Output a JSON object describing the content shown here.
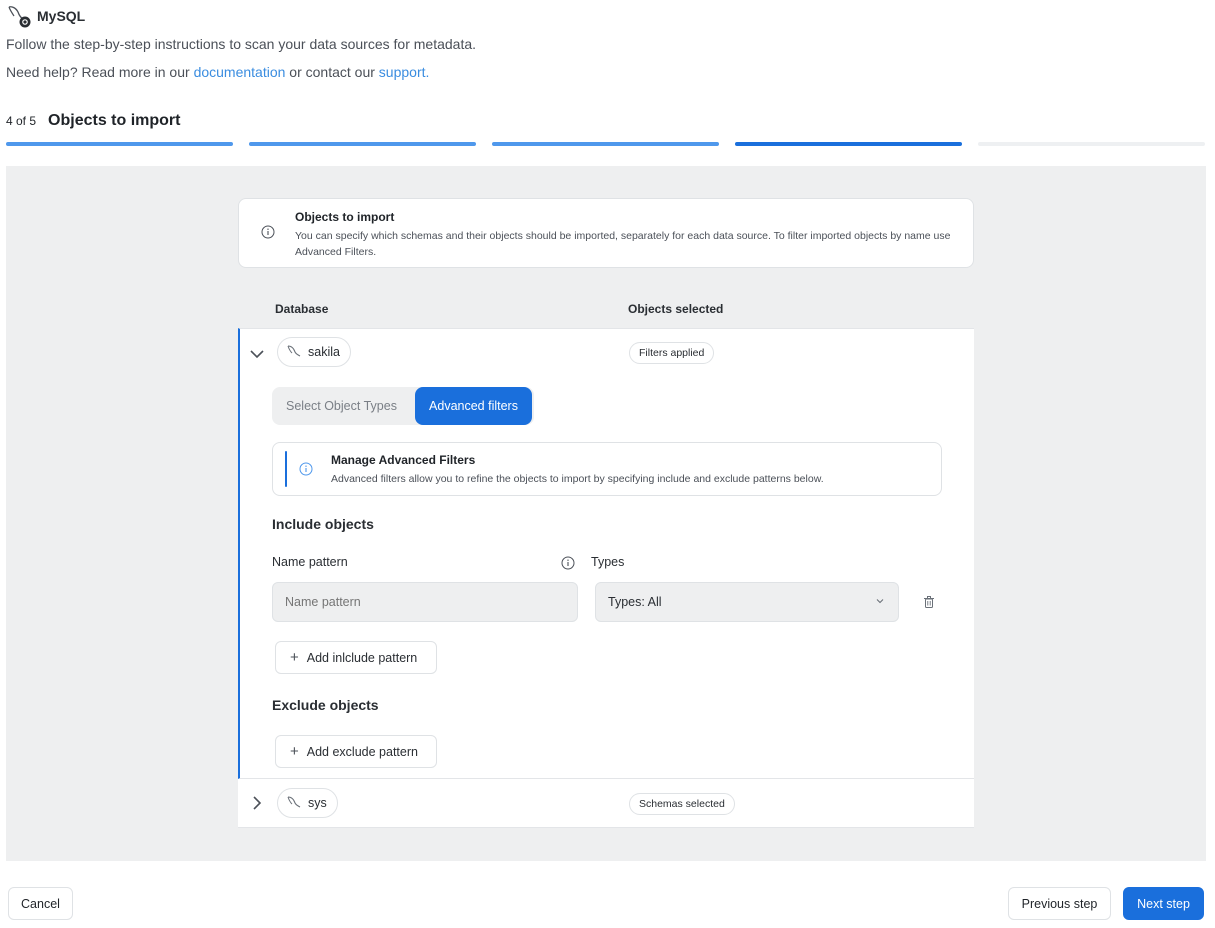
{
  "app": {
    "title": "MySQL",
    "icon": "mysql-dolphin-icon"
  },
  "intro": {
    "text": "Follow the step-by-step instructions to scan your data sources for metadata.",
    "help_prefix": "Need help? Read more in our ",
    "documentation_link": "documentation",
    "help_middle": " or contact our ",
    "support_link": "support."
  },
  "wizard": {
    "step_count": "4 of 5",
    "step_title": "Objects to import",
    "current_step": 4,
    "total_steps": 5
  },
  "info": {
    "title": "Objects to import",
    "description": "You can specify which schemas and their objects should be imported, separately for each data source. To filter imported objects by name use Advanced Filters."
  },
  "table": {
    "col_database": "Database",
    "col_objects": "Objects selected",
    "rows": [
      {
        "name": "sakila",
        "status": "Filters applied",
        "expanded": true
      },
      {
        "name": "sys",
        "status": "Schemas selected",
        "expanded": false
      }
    ]
  },
  "filters": {
    "tab_object_types": "Select Object Types",
    "tab_advanced": "Advanced filters",
    "adv_title": "Manage Advanced Filters",
    "adv_description": "Advanced filters allow you to refine the objects to import by specifying include and exclude patterns below.",
    "include_title": "Include objects",
    "name_pattern_label": "Name pattern",
    "name_pattern_placeholder": "Name pattern",
    "types_label": "Types",
    "types_value": "Types: All",
    "add_include": "Add inlclude pattern",
    "exclude_title": "Exclude objects",
    "add_exclude": "Add exclude pattern"
  },
  "footer": {
    "cancel": "Cancel",
    "previous": "Previous step",
    "next": "Next step"
  },
  "colors": {
    "accent": "#1a6fdc",
    "progress_done": "#4f98ec",
    "progress_todo": "#eef0f2",
    "link": "#3b8de0",
    "panel_bg": "#eeeff0"
  }
}
